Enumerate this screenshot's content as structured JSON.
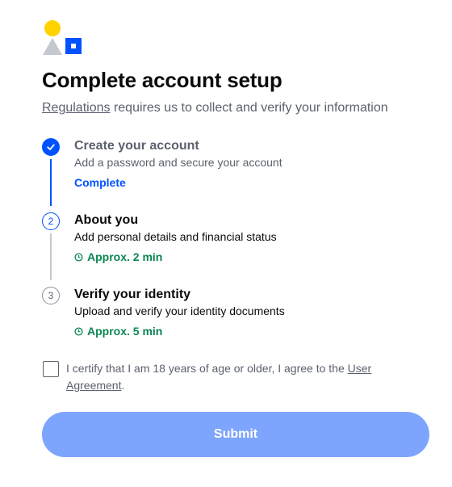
{
  "header": {
    "title": "Complete account setup",
    "subtitle_link": "Regulations",
    "subtitle_rest": " requires us to collect and verify your information"
  },
  "steps": [
    {
      "number": "",
      "title": "Create your account",
      "description": "Add a password and secure your account",
      "status": "Complete",
      "state": "done"
    },
    {
      "number": "2",
      "title": "About you",
      "description": "Add personal details and financial status",
      "status": "Approx. 2 min",
      "state": "active"
    },
    {
      "number": "3",
      "title": "Verify your identity",
      "description": "Upload and verify your identity documents",
      "status": "Approx. 5 min",
      "state": "pending"
    }
  ],
  "certify": {
    "text_before": "I certify that I am 18 years of age or older, I agree to the ",
    "link": "User Agreement",
    "text_after": ".",
    "checked": false
  },
  "submit": {
    "label": "Submit",
    "enabled": false
  },
  "colors": {
    "accent": "#0052ff",
    "time_green": "#098551",
    "submit_disabled": "#7ea5fd",
    "logo_yellow": "#ffd200",
    "logo_gray": "#c4c8cf"
  }
}
